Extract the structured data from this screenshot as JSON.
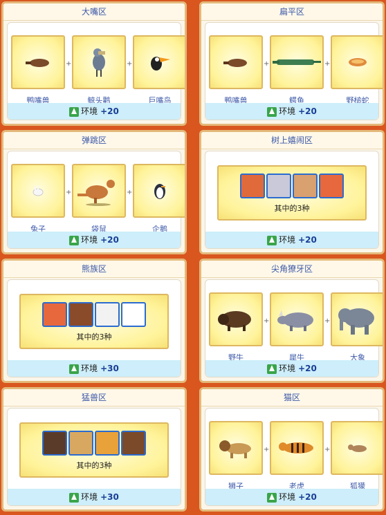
{
  "panels": [
    {
      "title": "大嘴区",
      "names": [
        "鸭嘴兽",
        "鲸头鹳",
        "巨嘴鸟"
      ],
      "env_label": "环境",
      "env_value": "+20"
    },
    {
      "title": "扁平区",
      "names": [
        "鸭嘴兽",
        "鳄鱼",
        "野槌蛇"
      ],
      "env_label": "环境",
      "env_value": "+20"
    },
    {
      "title": "弹跳区",
      "names": [
        "兔子",
        "袋鼠",
        "企鹅"
      ],
      "env_label": "环境",
      "env_value": "+20"
    },
    {
      "title": "树上嬉闹区",
      "subtitle": "其中的3种",
      "env_label": "环境",
      "env_value": "+20"
    },
    {
      "title": "熊族区",
      "subtitle": "其中的3种",
      "env_label": "环境",
      "env_value": "+30"
    },
    {
      "title": "尖角獠牙区",
      "names": [
        "野牛",
        "犀牛",
        "大象"
      ],
      "env_label": "环境",
      "env_value": "+20"
    },
    {
      "title": "猛兽区",
      "subtitle": "其中的3种",
      "env_label": "环境",
      "env_value": "+30"
    },
    {
      "title": "猫区",
      "names": [
        "狮子",
        "老虎",
        "狐獴"
      ],
      "env_label": "环境",
      "env_value": "+20"
    }
  ],
  "colors": {
    "title": "#3b58a8",
    "env_bg": "#cdeefa",
    "tree": "#3aa44a"
  }
}
